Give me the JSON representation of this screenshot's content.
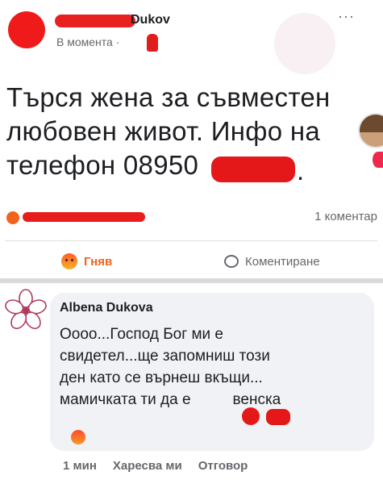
{
  "post": {
    "author_name": "Dukov",
    "time_label": "В момента ·",
    "more_icon": "···",
    "text_lines": [
      "Търся жена за съвместен",
      "любовен живот. Инфо на",
      "телефон 08950"
    ],
    "phone_end": ".",
    "comments_count": "1 коментар",
    "react_label": "Гняв",
    "comment_label": "Коментиране"
  },
  "comment": {
    "author": "Albena Dukova",
    "text_lines": [
      "Оооо...Господ Бог ми е",
      "свидетел...ще запомниш този",
      "ден като се върнеш вкъщи...",
      "мамичката ти да е",
      "венска"
    ],
    "actions": [
      "1 мин",
      "Харесва ми",
      "Отговор"
    ]
  },
  "icons": {
    "more": "more-horizontal-icon",
    "angry": "angry-reaction-icon",
    "comment": "comment-bubble-icon",
    "avatar": "flower-avatar-icon"
  },
  "colors": {
    "redaction": "#e41818",
    "angry": "#f0641e",
    "secondary_text": "#65676b",
    "bubble": "#f0f2f5"
  }
}
